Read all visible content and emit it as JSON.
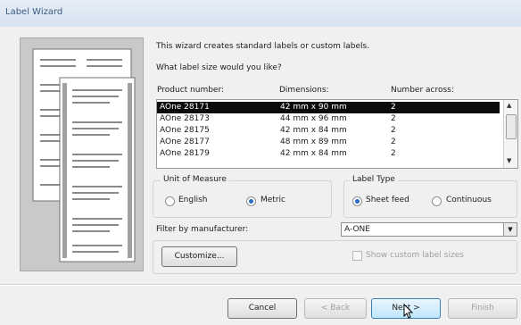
{
  "window": {
    "title": "Label Wizard"
  },
  "intro": {
    "line1": "This wizard creates standard labels or custom labels.",
    "line2": "What label size would you like?"
  },
  "columns": {
    "product": "Product number:",
    "dimensions": "Dimensions:",
    "across": "Number across:"
  },
  "labels": [
    {
      "product": "AOne 28171",
      "dimensions": "42 mm x 90 mm",
      "across": "2",
      "selected": true
    },
    {
      "product": "AOne 28173",
      "dimensions": "44 mm x 96 mm",
      "across": "2",
      "selected": false
    },
    {
      "product": "AOne 28175",
      "dimensions": "42 mm x 84 mm",
      "across": "2",
      "selected": false
    },
    {
      "product": "AOne 28177",
      "dimensions": "48 mm x 89 mm",
      "across": "2",
      "selected": false
    },
    {
      "product": "AOne 28179",
      "dimensions": "42 mm x 84 mm",
      "across": "2",
      "selected": false
    }
  ],
  "unit": {
    "legend": "Unit of Measure",
    "english": "English",
    "metric": "Metric",
    "selected": "Metric"
  },
  "labelType": {
    "legend": "Label Type",
    "sheet": "Sheet feed",
    "continuous": "Continuous",
    "selected": "Sheet feed"
  },
  "filter": {
    "label": "Filter by manufacturer:",
    "value": "A-ONE"
  },
  "customize_label": "Customize...",
  "show_custom_label": "Show custom label sizes",
  "buttons": {
    "cancel": "Cancel",
    "back": "< Back",
    "next": "Next >",
    "finish": "Finish"
  },
  "icons": {
    "scroll_up": "scroll-up-arrow-icon",
    "scroll_down": "scroll-down-arrow-icon",
    "dropdown": "chevron-down-icon",
    "cursor": "mouse-pointer-icon"
  },
  "colors": {
    "accent": "#2b69c7",
    "selection": "#0b0b0b",
    "title_text": "#3c5a80"
  }
}
